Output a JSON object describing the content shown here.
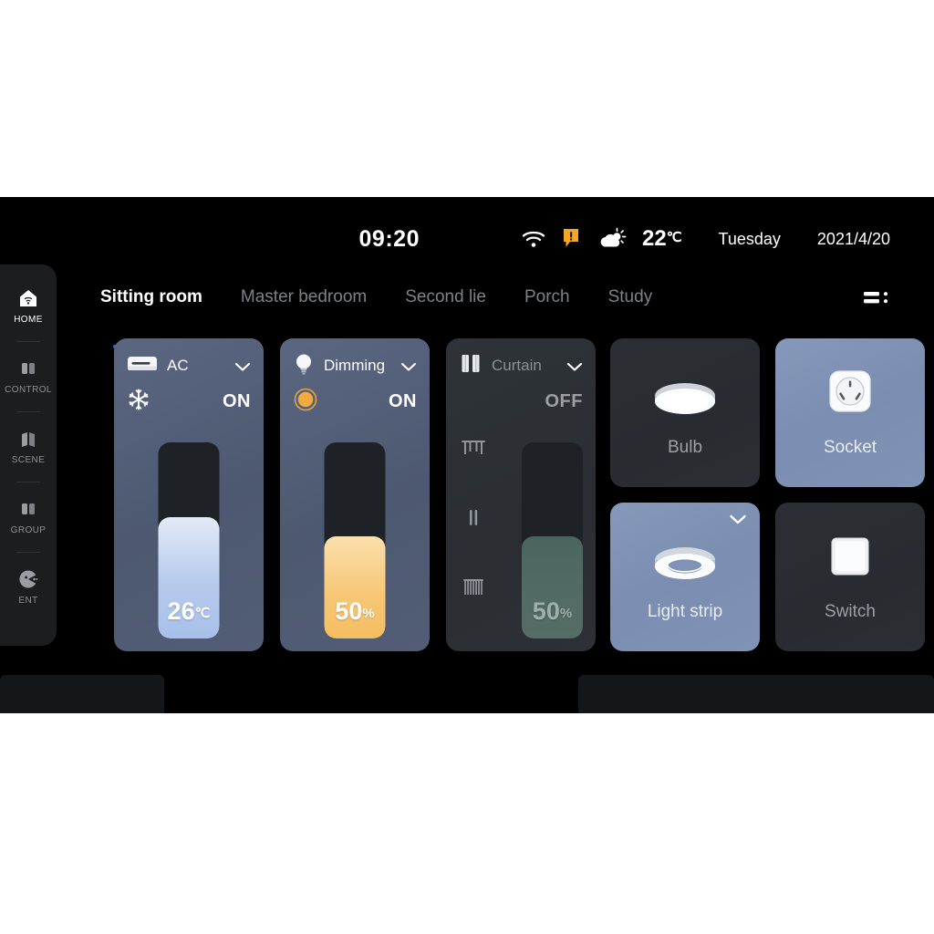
{
  "statusbar": {
    "clock": "09:20",
    "wifi_icon": "wifi-icon",
    "alert_icon": "alert-badge-icon",
    "weather_icon": "partly-cloudy-icon",
    "temperature": "22",
    "temperature_unit": "℃",
    "weekday": "Tuesday",
    "date": "2021/4/20"
  },
  "sidebar": {
    "items": [
      {
        "label": "HOME",
        "icon": "home-icon",
        "active": true
      },
      {
        "label": "CONTROL",
        "icon": "control-icon",
        "active": false
      },
      {
        "label": "SCENE",
        "icon": "scene-icon",
        "active": false
      },
      {
        "label": "GROUP",
        "icon": "group-icon",
        "active": false
      },
      {
        "label": "ENT",
        "icon": "ent-icon",
        "active": false
      }
    ]
  },
  "tabs": {
    "items": [
      {
        "label": "Sitting room",
        "active": true
      },
      {
        "label": "Master bedroom",
        "active": false
      },
      {
        "label": "Second lie",
        "active": false
      },
      {
        "label": "Porch",
        "active": false
      },
      {
        "label": "Study",
        "active": false
      }
    ],
    "menu_icon": "list-menu-icon"
  },
  "cards": [
    {
      "id": "ac",
      "title": "AC",
      "icon": "air-conditioner-icon",
      "mode_icon": "snowflake-icon",
      "state": "ON",
      "powered": true,
      "value": "26",
      "unit": "℃",
      "fill_percent": 62
    },
    {
      "id": "dimming",
      "title": "Dimming",
      "icon": "bulb-icon",
      "mode_icon": "brightness-dot-icon",
      "state": "ON",
      "powered": true,
      "value": "50",
      "unit": "%",
      "fill_percent": 52
    },
    {
      "id": "curtain",
      "title": "Curtain",
      "icon": "curtain-icon",
      "state": "OFF",
      "powered": false,
      "value": "50",
      "unit": "%",
      "fill_percent": 52,
      "modes": [
        {
          "name": "curtain-open-icon",
          "label": "open"
        },
        {
          "name": "curtain-pause-icon",
          "label": "pause"
        },
        {
          "name": "curtain-close-icon",
          "label": "close"
        }
      ]
    }
  ],
  "tiles": [
    {
      "id": "bulb",
      "label": "Bulb",
      "icon": "ceiling-light-icon",
      "on": false,
      "chevron": false
    },
    {
      "id": "socket",
      "label": "Socket",
      "icon": "power-socket-icon",
      "on": true,
      "chevron": false
    },
    {
      "id": "lightstrip",
      "label": "Light strip",
      "icon": "ring-light-icon",
      "on": true,
      "chevron": true
    },
    {
      "id": "switch",
      "label": "Switch",
      "icon": "wall-switch-icon",
      "on": false,
      "chevron": false
    }
  ],
  "colors": {
    "background": "#000000",
    "accent_blue": "#2f6fe0",
    "card_on": "#525d76",
    "card_off": "#2b2f34",
    "tile_on": "#8093b6",
    "ac_fill": "#b6caec",
    "dim_fill": "#f5bd61",
    "curtain_fill": "#536b64",
    "alert_orange": "#f5a623"
  }
}
